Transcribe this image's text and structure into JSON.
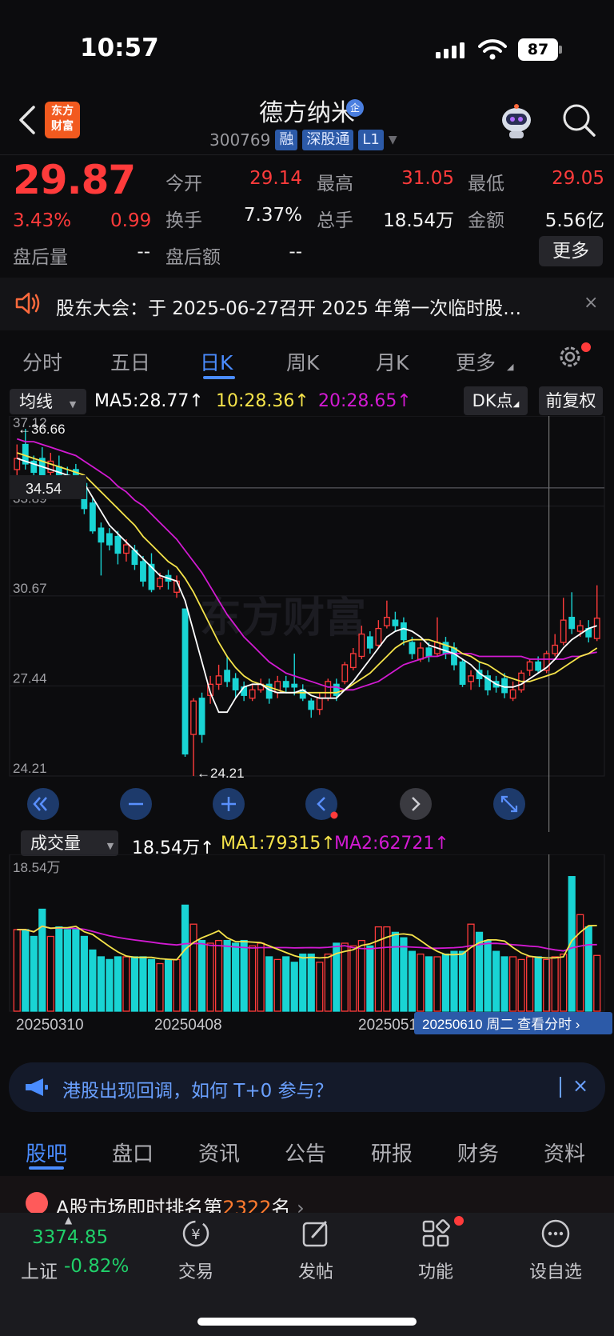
{
  "status_bar": {
    "time": "10:57",
    "battery": "87"
  },
  "header": {
    "logo_text": "东方\n财富",
    "stock_name": "德方纳米",
    "enterprise_badge": "企",
    "code": "300769",
    "tags": [
      "融",
      "深股通",
      "L1"
    ]
  },
  "quote": {
    "price": "29.87",
    "change_pct": "3.43%",
    "change_amt": "0.99",
    "items": [
      {
        "label": "今开",
        "value": "29.14",
        "color": "#ff3b3b"
      },
      {
        "label": "最高",
        "value": "31.05",
        "color": "#ff3b3b"
      },
      {
        "label": "最低",
        "value": "29.05",
        "color": "#ff3b3b"
      },
      {
        "label": "换手",
        "value": "7.37%",
        "color": "#f2f2f2"
      },
      {
        "label": "总手",
        "value": "18.54万",
        "color": "#f2f2f2"
      },
      {
        "label": "金额",
        "value": "5.56亿",
        "color": "#f2f2f2"
      },
      {
        "label": "盘后量",
        "value": "--",
        "color": "#f2f2f2"
      },
      {
        "label": "盘后额",
        "value": "--",
        "color": "#f2f2f2"
      }
    ],
    "more_label": "更多"
  },
  "notice": {
    "text": "股东大会：于 2025-06-27召开 2025 年第一次临时股…",
    "close": "×"
  },
  "tabs": {
    "items": [
      "分时",
      "五日",
      "日K",
      "周K",
      "月K",
      "更多"
    ],
    "active_index": 2
  },
  "indicator_row": {
    "dropdown": "均线",
    "ma5": "MA5:28.77↑",
    "ma10": "10:28.36↑",
    "ma20": "20:28.65↑",
    "dk_button": "DK点",
    "fq_button": "前复权",
    "colors": {
      "ma5": "#ffffff",
      "ma10": "#f5e34a",
      "ma20": "#d21ad2"
    }
  },
  "chart_data": {
    "type": "candlestick",
    "y_ticks": [
      "37.12",
      "33.89",
      "30.67",
      "27.44",
      "24.21"
    ],
    "ylim": [
      24.21,
      37.12
    ],
    "max_marker": "36.66",
    "min_marker": "24.21",
    "crosshair_price": "34.54",
    "watermark": "东方财富",
    "candles": [
      {
        "o": 35.2,
        "c": 35.6,
        "h": 36.1,
        "l": 35.0,
        "up": true
      },
      {
        "o": 36.1,
        "c": 35.4,
        "h": 36.66,
        "l": 35.2,
        "up": false
      },
      {
        "o": 35.5,
        "c": 35.1,
        "h": 35.7,
        "l": 34.9,
        "up": false
      },
      {
        "o": 35.6,
        "c": 35.0,
        "h": 36.0,
        "l": 34.8,
        "up": false
      },
      {
        "o": 35.1,
        "c": 35.5,
        "h": 35.8,
        "l": 34.9,
        "up": true
      },
      {
        "o": 35.3,
        "c": 34.9,
        "h": 35.7,
        "l": 34.7,
        "up": false
      },
      {
        "o": 35.0,
        "c": 34.7,
        "h": 35.3,
        "l": 34.5,
        "up": false
      },
      {
        "o": 35.2,
        "c": 34.6,
        "h": 35.4,
        "l": 34.4,
        "up": false
      },
      {
        "o": 34.7,
        "c": 33.8,
        "h": 34.9,
        "l": 33.6,
        "up": false
      },
      {
        "o": 34.0,
        "c": 33.0,
        "h": 34.2,
        "l": 32.9,
        "up": false
      },
      {
        "o": 33.1,
        "c": 32.6,
        "h": 33.3,
        "l": 31.4,
        "up": false
      },
      {
        "o": 32.9,
        "c": 32.5,
        "h": 33.1,
        "l": 32.3,
        "up": false
      },
      {
        "o": 32.8,
        "c": 32.2,
        "h": 33.0,
        "l": 31.8,
        "up": false
      },
      {
        "o": 32.2,
        "c": 32.5,
        "h": 32.7,
        "l": 31.9,
        "up": true
      },
      {
        "o": 32.3,
        "c": 31.8,
        "h": 32.5,
        "l": 31.6,
        "up": false
      },
      {
        "o": 31.9,
        "c": 31.2,
        "h": 32.1,
        "l": 31.0,
        "up": false
      },
      {
        "o": 31.8,
        "c": 30.9,
        "h": 32.2,
        "l": 30.8,
        "up": false
      },
      {
        "o": 31.0,
        "c": 31.3,
        "h": 31.5,
        "l": 30.9,
        "up": true
      },
      {
        "o": 31.4,
        "c": 31.2,
        "h": 31.6,
        "l": 30.9,
        "up": false
      },
      {
        "o": 30.8,
        "c": 31.2,
        "h": 31.4,
        "l": 30.6,
        "up": true
      },
      {
        "o": 30.2,
        "c": 25.0,
        "h": 30.1,
        "l": 24.9,
        "up": false
      },
      {
        "o": 25.7,
        "c": 26.9,
        "h": 27.0,
        "l": 24.21,
        "up": true
      },
      {
        "o": 27.0,
        "c": 25.7,
        "h": 27.2,
        "l": 25.4,
        "up": false
      },
      {
        "o": 27.1,
        "c": 27.5,
        "h": 27.8,
        "l": 26.8,
        "up": true
      },
      {
        "o": 27.5,
        "c": 27.8,
        "h": 28.2,
        "l": 27.3,
        "up": true
      },
      {
        "o": 28.0,
        "c": 27.6,
        "h": 28.5,
        "l": 27.4,
        "up": false
      },
      {
        "o": 27.7,
        "c": 27.3,
        "h": 27.9,
        "l": 27.0,
        "up": false
      },
      {
        "o": 27.4,
        "c": 27.1,
        "h": 27.6,
        "l": 26.9,
        "up": false
      },
      {
        "o": 27.0,
        "c": 27.3,
        "h": 27.5,
        "l": 26.9,
        "up": true
      },
      {
        "o": 27.3,
        "c": 27.5,
        "h": 27.7,
        "l": 27.2,
        "up": true
      },
      {
        "o": 27.5,
        "c": 27.0,
        "h": 27.7,
        "l": 26.8,
        "up": false
      },
      {
        "o": 27.2,
        "c": 27.6,
        "h": 27.8,
        "l": 27.0,
        "up": true
      },
      {
        "o": 27.6,
        "c": 27.4,
        "h": 27.8,
        "l": 27.2,
        "up": false
      },
      {
        "o": 27.5,
        "c": 27.4,
        "h": 28.6,
        "l": 27.1,
        "up": false
      },
      {
        "o": 27.3,
        "c": 27.0,
        "h": 27.5,
        "l": 26.9,
        "up": false
      },
      {
        "o": 26.9,
        "c": 26.6,
        "h": 27.0,
        "l": 26.3,
        "up": false
      },
      {
        "o": 26.6,
        "c": 27.0,
        "h": 27.2,
        "l": 26.4,
        "up": true
      },
      {
        "o": 27.0,
        "c": 27.6,
        "h": 27.7,
        "l": 26.9,
        "up": true
      },
      {
        "o": 27.5,
        "c": 27.1,
        "h": 27.7,
        "l": 26.9,
        "up": false
      },
      {
        "o": 27.6,
        "c": 28.2,
        "h": 28.3,
        "l": 27.5,
        "up": true
      },
      {
        "o": 28.1,
        "c": 28.6,
        "h": 28.8,
        "l": 28.0,
        "up": true
      },
      {
        "o": 28.5,
        "c": 29.3,
        "h": 29.6,
        "l": 28.4,
        "up": true
      },
      {
        "o": 29.2,
        "c": 28.8,
        "h": 29.4,
        "l": 28.6,
        "up": false
      },
      {
        "o": 28.9,
        "c": 29.5,
        "h": 29.8,
        "l": 28.8,
        "up": true
      },
      {
        "o": 29.6,
        "c": 29.9,
        "h": 30.5,
        "l": 29.5,
        "up": true
      },
      {
        "o": 29.8,
        "c": 29.6,
        "h": 30.1,
        "l": 29.4,
        "up": false
      },
      {
        "o": 29.7,
        "c": 29.1,
        "h": 29.9,
        "l": 28.9,
        "up": false
      },
      {
        "o": 29.0,
        "c": 28.6,
        "h": 29.2,
        "l": 28.4,
        "up": false
      },
      {
        "o": 28.4,
        "c": 28.8,
        "h": 29.0,
        "l": 28.3,
        "up": true
      },
      {
        "o": 28.8,
        "c": 28.5,
        "h": 29.0,
        "l": 28.3,
        "up": false
      },
      {
        "o": 28.6,
        "c": 29.0,
        "h": 29.9,
        "l": 28.5,
        "up": true
      },
      {
        "o": 29.0,
        "c": 28.6,
        "h": 29.2,
        "l": 28.4,
        "up": false
      },
      {
        "o": 28.8,
        "c": 28.2,
        "h": 29.0,
        "l": 28.0,
        "up": false
      },
      {
        "o": 28.3,
        "c": 27.5,
        "h": 28.4,
        "l": 27.4,
        "up": false
      },
      {
        "o": 27.6,
        "c": 27.8,
        "h": 28.0,
        "l": 27.3,
        "up": true
      },
      {
        "o": 28.0,
        "c": 27.7,
        "h": 28.3,
        "l": 27.4,
        "up": false
      },
      {
        "o": 27.8,
        "c": 27.3,
        "h": 28.0,
        "l": 27.1,
        "up": false
      },
      {
        "o": 27.6,
        "c": 27.4,
        "h": 27.8,
        "l": 27.2,
        "up": false
      },
      {
        "o": 27.7,
        "c": 27.2,
        "h": 27.9,
        "l": 27.0,
        "up": false
      },
      {
        "o": 27.0,
        "c": 27.3,
        "h": 27.6,
        "l": 26.9,
        "up": true
      },
      {
        "o": 27.3,
        "c": 27.9,
        "h": 28.0,
        "l": 27.2,
        "up": true
      },
      {
        "o": 28.0,
        "c": 28.3,
        "h": 28.4,
        "l": 27.8,
        "up": true
      },
      {
        "o": 28.3,
        "c": 28.0,
        "h": 28.5,
        "l": 27.9,
        "up": false
      },
      {
        "o": 28.0,
        "c": 28.6,
        "h": 28.7,
        "l": 27.9,
        "up": true
      },
      {
        "o": 28.6,
        "c": 28.9,
        "h": 29.3,
        "l": 28.5,
        "up": true
      },
      {
        "o": 29.0,
        "c": 29.8,
        "h": 30.6,
        "l": 28.9,
        "up": true
      },
      {
        "o": 29.9,
        "c": 29.5,
        "h": 30.8,
        "l": 29.3,
        "up": false
      },
      {
        "o": 29.4,
        "c": 29.6,
        "h": 29.8,
        "l": 29.2,
        "up": true
      },
      {
        "o": 29.5,
        "c": 29.2,
        "h": 29.8,
        "l": 29.0,
        "up": false
      },
      {
        "o": 29.14,
        "c": 29.87,
        "h": 31.05,
        "l": 29.05,
        "up": true
      }
    ],
    "ma5": [
      35.6,
      35.5,
      35.4,
      35.3,
      35.2,
      35.1,
      35.0,
      34.9,
      34.7,
      34.2,
      33.7,
      33.2,
      32.9,
      32.6,
      32.3,
      32.0,
      31.7,
      31.4,
      31.3,
      31.2,
      30.5,
      29.4,
      28.3,
      27.2,
      26.5,
      26.5,
      27.0,
      27.4,
      27.5,
      27.5,
      27.3,
      27.2,
      27.2,
      27.2,
      27.3,
      27.1,
      27.0,
      27.0,
      27.0,
      27.3,
      27.6,
      28.0,
      28.4,
      28.8,
      29.2,
      29.4,
      29.5,
      29.4,
      29.2,
      28.9,
      28.8,
      28.7,
      28.6,
      28.4,
      28.2,
      27.9,
      27.7,
      27.5,
      27.4,
      27.4,
      27.5,
      27.7,
      27.9,
      28.1,
      28.4,
      28.8,
      29.1,
      29.3,
      29.5,
      29.6
    ],
    "ma10": [
      35.8,
      35.7,
      35.6,
      35.5,
      35.4,
      35.3,
      35.2,
      35.1,
      35.0,
      34.7,
      34.4,
      34.1,
      33.8,
      33.5,
      33.2,
      32.8,
      32.5,
      32.2,
      31.9,
      31.7,
      31.3,
      30.8,
      30.2,
      29.6,
      29.0,
      28.5,
      28.1,
      27.8,
      27.6,
      27.5,
      27.4,
      27.3,
      27.2,
      27.2,
      27.2,
      27.2,
      27.2,
      27.2,
      27.2,
      27.3,
      27.5,
      27.7,
      27.9,
      28.2,
      28.5,
      28.8,
      29.0,
      29.1,
      29.1,
      29.1,
      29.0,
      28.9,
      28.8,
      28.6,
      28.5,
      28.3,
      28.2,
      28.0,
      27.8,
      27.7,
      27.6,
      27.6,
      27.7,
      27.8,
      27.9,
      28.1,
      28.3,
      28.5,
      28.6,
      28.8
    ],
    "ma20": [
      36.3,
      36.2,
      36.2,
      36.1,
      36.0,
      35.9,
      35.8,
      35.7,
      35.5,
      35.3,
      35.1,
      34.9,
      34.6,
      34.4,
      34.1,
      33.9,
      33.6,
      33.3,
      33.0,
      32.7,
      32.3,
      31.9,
      31.5,
      31.0,
      30.5,
      30.0,
      29.6,
      29.2,
      28.9,
      28.6,
      28.3,
      28.1,
      27.9,
      27.8,
      27.7,
      27.6,
      27.5,
      27.4,
      27.4,
      27.3,
      27.3,
      27.4,
      27.5,
      27.6,
      27.8,
      28.0,
      28.2,
      28.3,
      28.4,
      28.5,
      28.5,
      28.6,
      28.6,
      28.6,
      28.6,
      28.5,
      28.5,
      28.5,
      28.5,
      28.5,
      28.5,
      28.4,
      28.4,
      28.4,
      28.4,
      28.4,
      28.5,
      28.5,
      28.6,
      28.65
    ]
  },
  "volume": {
    "dropdown": "成交量",
    "value": "18.54万↑",
    "ma1": "MA1:79315↑",
    "ma2": "MA2:62721↑",
    "axis_label": "18.54万",
    "dates": [
      "20250310",
      "20250408",
      "2025051",
      "2025061"
    ],
    "tooltip": "20250610 周二  查看分时",
    "bars": [
      60,
      60,
      55,
      75,
      55,
      62,
      60,
      60,
      55,
      45,
      40,
      38,
      40,
      40,
      40,
      40,
      38,
      35,
      38,
      38,
      78,
      64,
      52,
      50,
      52,
      52,
      50,
      52,
      48,
      50,
      40,
      38,
      40,
      36,
      42,
      42,
      36,
      42,
      50,
      50,
      48,
      52,
      48,
      62,
      62,
      58,
      54,
      44,
      42,
      40,
      40,
      42,
      44,
      44,
      64,
      58,
      52,
      44,
      40,
      40,
      38,
      40,
      40,
      38,
      40,
      42,
      99,
      71,
      62,
      41
    ],
    "bar_up": [
      true,
      false,
      false,
      false,
      true,
      false,
      false,
      false,
      false,
      false,
      false,
      false,
      false,
      true,
      false,
      false,
      false,
      true,
      false,
      true,
      false,
      true,
      false,
      true,
      true,
      false,
      false,
      false,
      true,
      true,
      false,
      true,
      false,
      false,
      false,
      false,
      true,
      true,
      false,
      true,
      true,
      true,
      false,
      true,
      true,
      false,
      false,
      false,
      true,
      false,
      true,
      false,
      false,
      false,
      true,
      false,
      false,
      false,
      false,
      true,
      true,
      true,
      false,
      true,
      true,
      true,
      false,
      true,
      false,
      true
    ],
    "vol_max": 100
  },
  "chart_buttons": [
    "fast-back",
    "zoom-out",
    "zoom-in",
    "prev",
    "next",
    "fullscreen"
  ],
  "banner": {
    "text": "港股出现回调，如何 T+0 参与？",
    "close": "×"
  },
  "bottom_tabs": {
    "items": [
      "股吧",
      "盘口",
      "资讯",
      "公告",
      "研报",
      "财务",
      "资料"
    ],
    "active_index": 0
  },
  "rank": {
    "prefix": "A股市场即时排名第",
    "number": "2322",
    "suffix": "名",
    "chevron": "›"
  },
  "nav": {
    "index_value": "3374.85",
    "index_name": "上证",
    "index_change": "-0.82%",
    "items": [
      {
        "label": "交易",
        "icon": "trade-icon"
      },
      {
        "label": "发帖",
        "icon": "post-icon"
      },
      {
        "label": "功能",
        "icon": "grid-icon"
      },
      {
        "label": "设自选",
        "icon": "more-icon"
      }
    ]
  }
}
